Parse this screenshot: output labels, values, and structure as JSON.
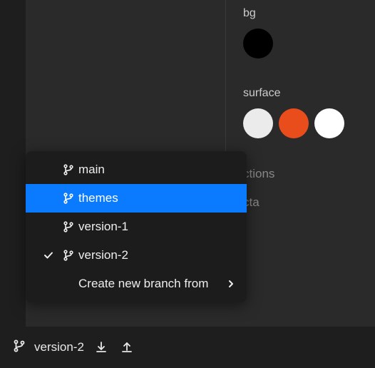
{
  "properties": {
    "bg": {
      "label": "bg",
      "colors": [
        "#000000"
      ]
    },
    "surface": {
      "label": "surface",
      "colors": [
        "#ebebeb",
        "#ea4d1c",
        "#ffffff"
      ]
    },
    "hidden": [
      {
        "label": "ctions"
      },
      {
        "label": "cta"
      }
    ]
  },
  "menu": {
    "items": [
      {
        "label": "main",
        "selected": false,
        "current": false
      },
      {
        "label": "themes",
        "selected": true,
        "current": false
      },
      {
        "label": "version-1",
        "selected": false,
        "current": false
      },
      {
        "label": "version-2",
        "selected": false,
        "current": true
      }
    ],
    "create_label": "Create new branch from"
  },
  "footer": {
    "branch_label": "version-2"
  }
}
